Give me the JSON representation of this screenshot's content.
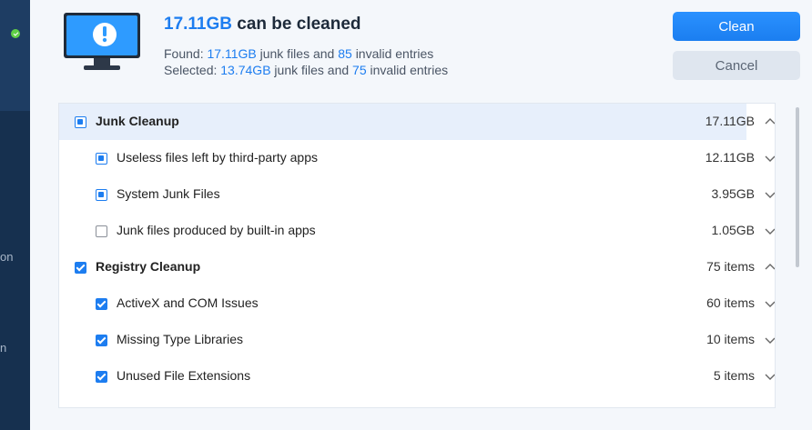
{
  "sidebar": {
    "fragments": [
      "on",
      "n"
    ]
  },
  "summary": {
    "title_size": "17.11GB",
    "title_rest": "can be cleaned",
    "found_prefix": "Found:",
    "found_size": "17.11GB",
    "found_mid": "junk files and",
    "found_invalid": "85",
    "found_suffix": "invalid entries",
    "selected_prefix": "Selected:",
    "selected_size": "13.74GB",
    "selected_mid": "junk files and",
    "selected_invalid": "75",
    "selected_suffix": "invalid entries"
  },
  "buttons": {
    "clean": "Clean",
    "cancel": "Cancel"
  },
  "rows": [
    {
      "label": "Junk Cleanup",
      "value": "17.11GB",
      "level": 0,
      "state": "partial",
      "expanded": true
    },
    {
      "label": "Useless files left by third-party apps",
      "value": "12.11GB",
      "level": 1,
      "state": "partial",
      "expanded": false
    },
    {
      "label": "System Junk Files",
      "value": "3.95GB",
      "level": 1,
      "state": "partial",
      "expanded": false
    },
    {
      "label": "Junk files produced by built-in apps",
      "value": "1.05GB",
      "level": 1,
      "state": "unchecked",
      "expanded": false
    },
    {
      "label": "Registry Cleanup",
      "value": "75 items",
      "level": 0,
      "state": "checked",
      "expanded": true
    },
    {
      "label": "ActiveX and COM Issues",
      "value": "60 items",
      "level": 1,
      "state": "checked",
      "expanded": false
    },
    {
      "label": "Missing Type Libraries",
      "value": "10 items",
      "level": 1,
      "state": "checked",
      "expanded": false
    },
    {
      "label": "Unused File Extensions",
      "value": "5 items",
      "level": 1,
      "state": "checked",
      "expanded": false
    }
  ],
  "colors": {
    "accent": "#1d7df0",
    "sidebar": "#16304f",
    "highlight_row": "#e7effb"
  },
  "icons": {
    "monitor": "monitor-warning-icon",
    "chevron_up": "chevron-up-icon",
    "chevron_down": "chevron-down-icon",
    "status_ok": "check-circle-icon"
  }
}
